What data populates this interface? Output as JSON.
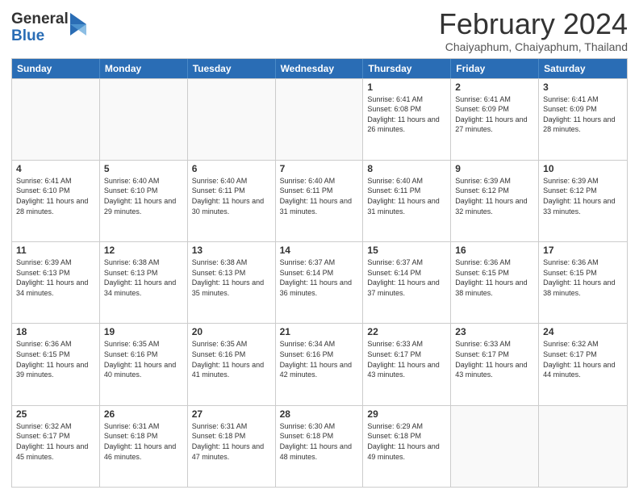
{
  "logo": {
    "general": "General",
    "blue": "Blue"
  },
  "header": {
    "month": "February 2024",
    "location": "Chaiyaphum, Chaiyaphum, Thailand"
  },
  "weekdays": [
    "Sunday",
    "Monday",
    "Tuesday",
    "Wednesday",
    "Thursday",
    "Friday",
    "Saturday"
  ],
  "weeks": [
    [
      {
        "day": "",
        "empty": true
      },
      {
        "day": "",
        "empty": true
      },
      {
        "day": "",
        "empty": true
      },
      {
        "day": "",
        "empty": true
      },
      {
        "day": "1",
        "sunrise": "6:41 AM",
        "sunset": "6:08 PM",
        "daylight": "11 hours and 26 minutes."
      },
      {
        "day": "2",
        "sunrise": "6:41 AM",
        "sunset": "6:09 PM",
        "daylight": "11 hours and 27 minutes."
      },
      {
        "day": "3",
        "sunrise": "6:41 AM",
        "sunset": "6:09 PM",
        "daylight": "11 hours and 28 minutes."
      }
    ],
    [
      {
        "day": "4",
        "sunrise": "6:41 AM",
        "sunset": "6:10 PM",
        "daylight": "11 hours and 28 minutes."
      },
      {
        "day": "5",
        "sunrise": "6:40 AM",
        "sunset": "6:10 PM",
        "daylight": "11 hours and 29 minutes."
      },
      {
        "day": "6",
        "sunrise": "6:40 AM",
        "sunset": "6:11 PM",
        "daylight": "11 hours and 30 minutes."
      },
      {
        "day": "7",
        "sunrise": "6:40 AM",
        "sunset": "6:11 PM",
        "daylight": "11 hours and 31 minutes."
      },
      {
        "day": "8",
        "sunrise": "6:40 AM",
        "sunset": "6:11 PM",
        "daylight": "11 hours and 31 minutes."
      },
      {
        "day": "9",
        "sunrise": "6:39 AM",
        "sunset": "6:12 PM",
        "daylight": "11 hours and 32 minutes."
      },
      {
        "day": "10",
        "sunrise": "6:39 AM",
        "sunset": "6:12 PM",
        "daylight": "11 hours and 33 minutes."
      }
    ],
    [
      {
        "day": "11",
        "sunrise": "6:39 AM",
        "sunset": "6:13 PM",
        "daylight": "11 hours and 34 minutes."
      },
      {
        "day": "12",
        "sunrise": "6:38 AM",
        "sunset": "6:13 PM",
        "daylight": "11 hours and 34 minutes."
      },
      {
        "day": "13",
        "sunrise": "6:38 AM",
        "sunset": "6:13 PM",
        "daylight": "11 hours and 35 minutes."
      },
      {
        "day": "14",
        "sunrise": "6:37 AM",
        "sunset": "6:14 PM",
        "daylight": "11 hours and 36 minutes."
      },
      {
        "day": "15",
        "sunrise": "6:37 AM",
        "sunset": "6:14 PM",
        "daylight": "11 hours and 37 minutes."
      },
      {
        "day": "16",
        "sunrise": "6:36 AM",
        "sunset": "6:15 PM",
        "daylight": "11 hours and 38 minutes."
      },
      {
        "day": "17",
        "sunrise": "6:36 AM",
        "sunset": "6:15 PM",
        "daylight": "11 hours and 38 minutes."
      }
    ],
    [
      {
        "day": "18",
        "sunrise": "6:36 AM",
        "sunset": "6:15 PM",
        "daylight": "11 hours and 39 minutes."
      },
      {
        "day": "19",
        "sunrise": "6:35 AM",
        "sunset": "6:16 PM",
        "daylight": "11 hours and 40 minutes."
      },
      {
        "day": "20",
        "sunrise": "6:35 AM",
        "sunset": "6:16 PM",
        "daylight": "11 hours and 41 minutes."
      },
      {
        "day": "21",
        "sunrise": "6:34 AM",
        "sunset": "6:16 PM",
        "daylight": "11 hours and 42 minutes."
      },
      {
        "day": "22",
        "sunrise": "6:33 AM",
        "sunset": "6:17 PM",
        "daylight": "11 hours and 43 minutes."
      },
      {
        "day": "23",
        "sunrise": "6:33 AM",
        "sunset": "6:17 PM",
        "daylight": "11 hours and 43 minutes."
      },
      {
        "day": "24",
        "sunrise": "6:32 AM",
        "sunset": "6:17 PM",
        "daylight": "11 hours and 44 minutes."
      }
    ],
    [
      {
        "day": "25",
        "sunrise": "6:32 AM",
        "sunset": "6:17 PM",
        "daylight": "11 hours and 45 minutes."
      },
      {
        "day": "26",
        "sunrise": "6:31 AM",
        "sunset": "6:18 PM",
        "daylight": "11 hours and 46 minutes."
      },
      {
        "day": "27",
        "sunrise": "6:31 AM",
        "sunset": "6:18 PM",
        "daylight": "11 hours and 47 minutes."
      },
      {
        "day": "28",
        "sunrise": "6:30 AM",
        "sunset": "6:18 PM",
        "daylight": "11 hours and 48 minutes."
      },
      {
        "day": "29",
        "sunrise": "6:29 AM",
        "sunset": "6:18 PM",
        "daylight": "11 hours and 49 minutes."
      },
      {
        "day": "",
        "empty": true
      },
      {
        "day": "",
        "empty": true
      }
    ]
  ]
}
